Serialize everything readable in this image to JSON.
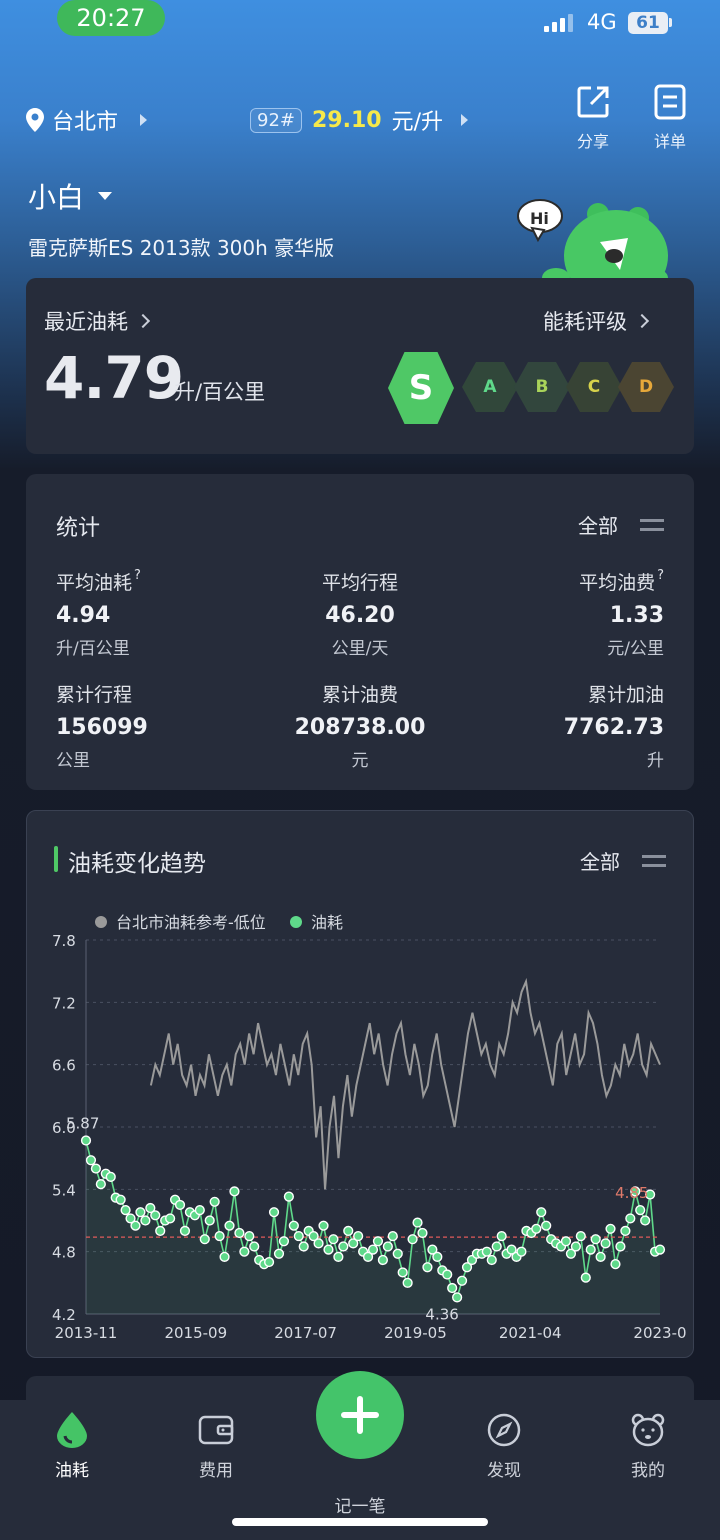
{
  "status": {
    "time": "20:27",
    "network": "4G",
    "battery": "61"
  },
  "header": {
    "city": "台北市",
    "fuel_grade": "92#",
    "fuel_price": "29.10",
    "price_unit": "元/升",
    "share_label": "分享",
    "detail_label": "详单"
  },
  "car": {
    "name": "小白",
    "model": "雷克萨斯ES 2013款 300h 豪华版"
  },
  "mascot": {
    "bubble": "Hi"
  },
  "recent": {
    "title": "最近油耗",
    "value": "4.79",
    "unit": "升/百公里",
    "rating_title": "能耗评级",
    "grades": [
      "S",
      "A",
      "B",
      "C",
      "D"
    ],
    "active_grade": "S",
    "colors": {
      "S": "#4fc866",
      "A": "#31473a",
      "B": "#32463d",
      "C": "#374335",
      "D": "#4b4532"
    }
  },
  "stats": {
    "title": "统计",
    "filter": "全部",
    "items": [
      {
        "label": "平均油耗",
        "value": "4.94",
        "unit": "升/百公里",
        "help": "?"
      },
      {
        "label": "平均行程",
        "value": "46.20",
        "unit": "公里/天"
      },
      {
        "label": "平均油费",
        "value": "1.33",
        "unit": "元/公里",
        "help": "?"
      },
      {
        "label": "累计行程",
        "value": "156099",
        "unit": "公里"
      },
      {
        "label": "累计油费",
        "value": "208738.00",
        "unit": "元"
      },
      {
        "label": "累计加油",
        "value": "7762.73",
        "unit": "升"
      }
    ]
  },
  "trend": {
    "title": "油耗变化趋势",
    "filter": "全部"
  },
  "chart_data": {
    "type": "line",
    "legend": [
      "台北市油耗参考-低位",
      "油耗"
    ],
    "legend_colors": [
      "#9a9a9a",
      "#5fd98a"
    ],
    "yticks": [
      "7.8",
      "7.2",
      "6.6",
      "6.0",
      "5.4",
      "4.8",
      "4.2"
    ],
    "ylim": [
      4.2,
      7.8
    ],
    "xticks": [
      "2013-11",
      "2015-09",
      "2017-07",
      "2019-05",
      "2021-04",
      "2023-0"
    ],
    "xlim": [
      "2013-11",
      "2023-06"
    ],
    "annotations": [
      {
        "label": "5.87",
        "x": "2013-11",
        "y": 5.87
      },
      {
        "label": "4.36",
        "x": "2019-07",
        "y": 4.36
      },
      {
        "label": "4.85",
        "x": "2022-09",
        "y": 5.2
      }
    ],
    "average_line": 4.94,
    "series": [
      {
        "name": "台北市油耗参考-低位",
        "x_start": "2014-12",
        "x_end": "2023-06",
        "values": [
          6.4,
          6.6,
          6.5,
          6.7,
          6.9,
          6.6,
          6.8,
          6.5,
          6.4,
          6.6,
          6.3,
          6.5,
          6.4,
          6.7,
          6.5,
          6.3,
          6.5,
          6.6,
          6.4,
          6.7,
          6.8,
          6.6,
          6.9,
          6.7,
          7.0,
          6.8,
          6.6,
          6.7,
          6.5,
          6.8,
          6.6,
          6.4,
          6.7,
          6.5,
          6.8,
          6.9,
          6.6,
          5.9,
          6.2,
          5.4,
          6.0,
          6.3,
          5.7,
          6.2,
          6.5,
          6.1,
          6.4,
          6.6,
          6.8,
          7.0,
          6.7,
          6.9,
          6.6,
          6.4,
          6.7,
          6.9,
          7.0,
          6.7,
          6.5,
          6.8,
          6.6,
          6.3,
          6.4,
          6.7,
          6.9,
          6.6,
          6.4,
          6.2,
          6.0,
          6.3,
          6.6,
          6.9,
          7.1,
          6.9,
          6.7,
          6.8,
          6.6,
          6.5,
          6.8,
          6.7,
          6.9,
          7.2,
          7.1,
          7.3,
          7.4,
          7.1,
          6.9,
          7.0,
          6.8,
          6.6,
          6.4,
          6.8,
          6.9,
          6.5,
          6.7,
          6.9,
          6.6,
          6.7,
          7.1,
          7.0,
          6.8,
          6.5,
          6.3,
          6.4,
          6.6,
          6.5,
          6.8,
          6.6,
          6.7,
          6.9,
          6.6,
          6.5,
          6.8,
          6.7,
          6.6
        ]
      },
      {
        "name": "油耗",
        "x_start": "2013-11",
        "x_end": "2023-06",
        "values": [
          5.87,
          5.68,
          5.6,
          5.45,
          5.55,
          5.52,
          5.32,
          5.3,
          5.2,
          5.12,
          5.05,
          5.18,
          5.1,
          5.22,
          5.15,
          5.0,
          5.1,
          5.12,
          5.3,
          5.25,
          5.0,
          5.18,
          5.15,
          5.2,
          4.92,
          5.1,
          5.28,
          4.95,
          4.75,
          5.05,
          5.38,
          4.98,
          4.8,
          4.95,
          4.85,
          4.72,
          4.68,
          4.7,
          5.18,
          4.78,
          4.9,
          5.33,
          5.05,
          4.95,
          4.85,
          5.0,
          4.95,
          4.88,
          5.05,
          4.82,
          4.92,
          4.75,
          4.85,
          5.0,
          4.88,
          4.95,
          4.8,
          4.75,
          4.82,
          4.9,
          4.72,
          4.85,
          4.95,
          4.78,
          4.6,
          4.5,
          4.92,
          5.08,
          4.98,
          4.65,
          4.82,
          4.75,
          4.62,
          4.58,
          4.45,
          4.36,
          4.52,
          4.65,
          4.72,
          4.78,
          4.78,
          4.8,
          4.72,
          4.85,
          4.95,
          4.78,
          4.82,
          4.75,
          4.8,
          5.0,
          4.98,
          5.02,
          5.18,
          5.05,
          4.92,
          4.88,
          4.85,
          4.9,
          4.78,
          4.85,
          4.95,
          4.55,
          4.82,
          4.92,
          4.75,
          4.88,
          5.02,
          4.68,
          4.85,
          5.0,
          5.12,
          5.38,
          5.2,
          5.1,
          5.35,
          4.8,
          4.82
        ]
      }
    ]
  },
  "nav": {
    "items": [
      "油耗",
      "费用",
      "发现",
      "我的"
    ],
    "add_label": "记一笔"
  }
}
